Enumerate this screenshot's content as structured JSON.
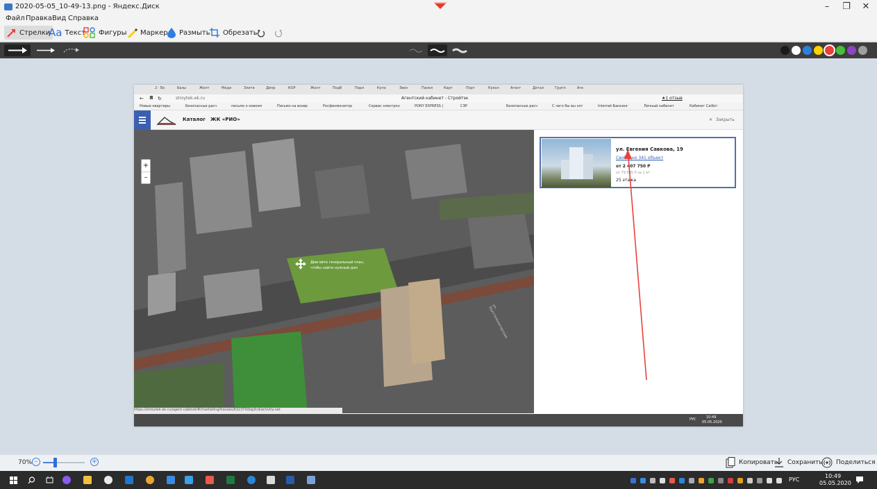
{
  "window": {
    "title": "2020-05-05_10-49-13.png - Яндекс.Диск",
    "minimize": "–",
    "restore": "❐",
    "close": "✕"
  },
  "menu": [
    "Файл",
    "Правка",
    "Вид",
    "Справка"
  ],
  "toolbar": {
    "arrows": "Стрелки",
    "text": "Текст",
    "text_icon": "Aa",
    "shapes": "Фигуры",
    "marker": "Маркер",
    "blur": "Размыть",
    "crop": "Обрезать"
  },
  "colors": {
    "accent": "#ee3b2c",
    "palette": [
      "#1a1a1a",
      "#ffffff",
      "#2f7fe0",
      "#ffd400",
      "#e8413b",
      "#46c038",
      "#8e44c4",
      "#9e9e9e"
    ]
  },
  "browser": {
    "tabs": [
      "2 · Вх",
      "Базы",
      "Желт",
      "Меди",
      "Злите",
      "Депр",
      "КОР",
      "Желт",
      "Подб",
      "Парл",
      "Купо",
      "Звон",
      "Панел",
      "Карт",
      "Порт",
      "Кукол",
      "Агент",
      "Детал",
      "Групп",
      "Аге"
    ],
    "url": "stroytek-ek.ru",
    "page_title": "Агентский кабинет - Стройтэк",
    "reviews": "★1 отзыв",
    "bookmarks": [
      "Новые квартиры",
      "Безопасные расч",
      "письмо о невозм",
      "Письмо на возвр",
      "Росфинмонитор",
      "Сервис электрон",
      "PONY EXPRESS |",
      "СЭР",
      "Безопасные расч",
      "С чего бы вы хот",
      "Internet-Банкинг",
      "Личный кабинет",
      "Кабинет Calibri"
    ],
    "status_url": "https://stroytek-ek.ru/agent-cabinet/#/marketing/houses/632370/big3cd/activity-set"
  },
  "site": {
    "breadcrumb_catalog": "Каталог",
    "breadcrumb_sep": "»",
    "breadcrumb_project": "ЖК «РИО»",
    "close": "Закрыть",
    "zoom_in": "+",
    "zoom_out": "–",
    "map_hint_1": "Двигайте генеральный план,",
    "map_hint_2": "чтобы найти нужный дом",
    "street": "ул. Хрустальногорская"
  },
  "card": {
    "address": "ул. Евгения Савкова, 19",
    "free_objects": "Свободно 341 объект",
    "price": "от 2 407 750 Р",
    "price_per_m2": "от 79 935 Р за 1 м²",
    "floors": "25 этажа"
  },
  "inner_clock": {
    "time": "10:49",
    "date": "05.05.2020",
    "lang": "РУС"
  },
  "zoom": {
    "level": "70%",
    "minus": "–",
    "plus": "+",
    "fraction": 0.28
  },
  "actions": {
    "copy": "Копировать",
    "save": "Сохранить",
    "share": "Поделиться"
  },
  "clock": {
    "time": "10:49",
    "date": "05.05.2020",
    "lang": "РУС"
  }
}
